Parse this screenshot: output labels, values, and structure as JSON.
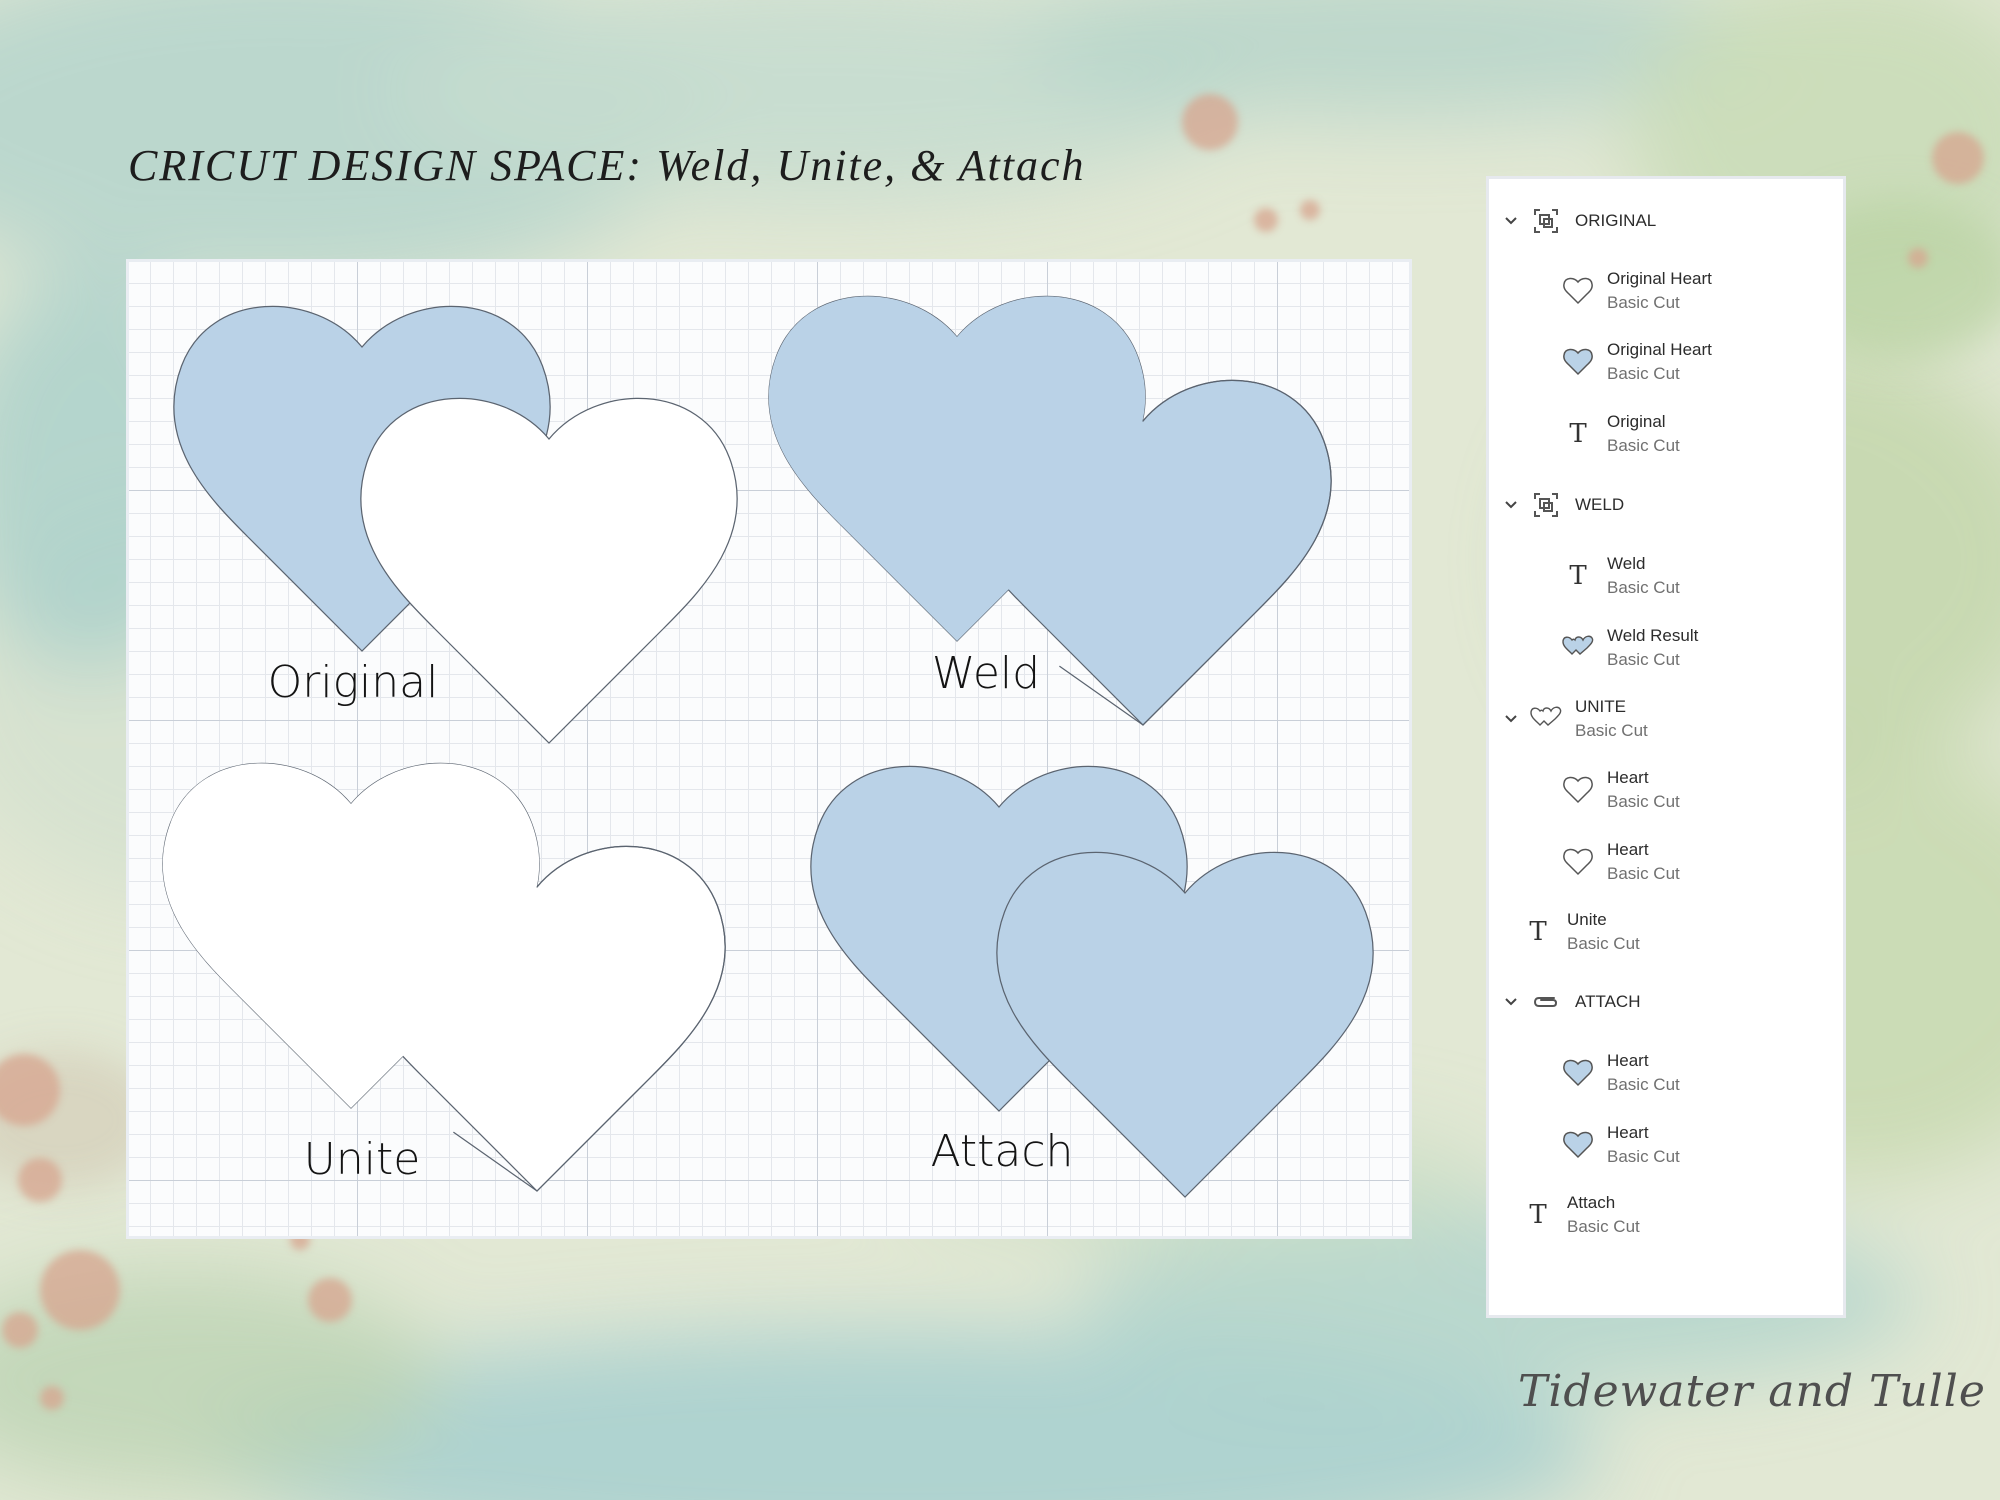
{
  "title": "CRICUT DESIGN SPACE: Weld, Unite, & Attach",
  "colors": {
    "shape_blue": "#bad2e7",
    "shape_white": "#ffffff",
    "grid_major": "#c9cfd8",
    "grid_minor": "#e4e7ec"
  },
  "canvas": {
    "labels": {
      "original": "Original",
      "weld": "Weld",
      "unite": "Unite",
      "attach": "Attach"
    }
  },
  "layers": {
    "groups": [
      {
        "name": "ORIGINAL",
        "icon": "group-icon",
        "items": [
          {
            "name": "Original Heart",
            "sub": "Basic Cut",
            "icon": "heart-outline-icon"
          },
          {
            "name": "Original Heart",
            "sub": "Basic Cut",
            "icon": "heart-filled-icon"
          },
          {
            "name": "Original",
            "sub": "Basic Cut",
            "icon": "text-icon"
          }
        ]
      },
      {
        "name": "WELD",
        "icon": "group-icon",
        "items": [
          {
            "name": "Weld",
            "sub": "Basic Cut",
            "icon": "text-icon"
          },
          {
            "name": "Weld Result",
            "sub": "Basic Cut",
            "icon": "double-heart-filled-icon"
          }
        ]
      },
      {
        "name": "UNITE",
        "sub": "Basic Cut",
        "icon": "double-heart-outline-icon",
        "items": [
          {
            "name": "Heart",
            "sub": "Basic Cut",
            "icon": "heart-outline-icon"
          },
          {
            "name": "Heart",
            "sub": "Basic Cut",
            "icon": "heart-outline-icon"
          }
        ]
      },
      {
        "name": "Unite",
        "sub": "Basic Cut",
        "icon": "text-icon"
      },
      {
        "name": "ATTACH",
        "icon": "paperclip-icon",
        "items": [
          {
            "name": "Heart",
            "sub": "Basic Cut",
            "icon": "heart-filled-icon"
          },
          {
            "name": "Heart",
            "sub": "Basic Cut",
            "icon": "heart-filled-icon"
          }
        ]
      },
      {
        "name": "Attach",
        "sub": "Basic Cut",
        "icon": "text-icon"
      }
    ]
  },
  "signature": "Tidewater and Tulle"
}
